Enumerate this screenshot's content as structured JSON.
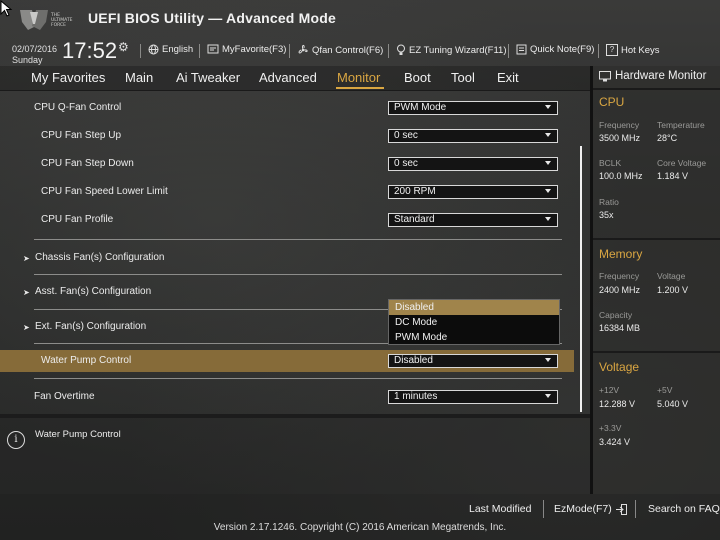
{
  "header": {
    "title": "UEFI BIOS Utility — Advanced Mode",
    "logo_text": "THE ULTIMATE FORCE",
    "date": "02/07/2016",
    "day": "Sunday",
    "time": "17:52",
    "items": [
      {
        "label": "English",
        "icon": "globe-icon"
      },
      {
        "label": "MyFavorite(F3)",
        "icon": "favorite-icon"
      },
      {
        "label": "Qfan Control(F6)",
        "icon": "fan-icon"
      },
      {
        "label": "EZ Tuning Wizard(F11)",
        "icon": "bulb-icon"
      },
      {
        "label": "Quick Note(F9)",
        "icon": "note-icon"
      },
      {
        "label": "Hot Keys",
        "icon": "help-icon"
      }
    ]
  },
  "menu": {
    "tabs": [
      "My Favorites",
      "Main",
      "Ai Tweaker",
      "Advanced",
      "Monitor",
      "Boot",
      "Tool",
      "Exit"
    ],
    "active": "Monitor"
  },
  "settings": {
    "cpu_qfan": {
      "label": "CPU Q-Fan Control",
      "value": "PWM Mode"
    },
    "step_up": {
      "label": "CPU Fan Step Up",
      "value": "0 sec"
    },
    "step_down": {
      "label": "CPU Fan Step Down",
      "value": "0 sec"
    },
    "lower_limit": {
      "label": "CPU Fan Speed Lower Limit",
      "value": "200 RPM"
    },
    "profile": {
      "label": "CPU Fan Profile",
      "value": "Standard"
    },
    "chassis": {
      "label": "Chassis Fan(s) Configuration"
    },
    "asst": {
      "label": "Asst. Fan(s) Configuration"
    },
    "ext": {
      "label": "Ext. Fan(s) Configuration"
    },
    "water_pump": {
      "label": "Water Pump Control",
      "value": "Disabled"
    },
    "fan_overtime": {
      "label": "Fan Overtime",
      "value": "1 minutes"
    }
  },
  "dropdown": {
    "options": [
      "Disabled",
      "DC Mode",
      "PWM Mode"
    ],
    "selected": "Disabled"
  },
  "help": {
    "text": "Water Pump Control"
  },
  "hw_monitor": {
    "title": "Hardware Monitor",
    "cpu": {
      "section": "CPU",
      "frequency_label": "Frequency",
      "frequency": "3500 MHz",
      "temperature_label": "Temperature",
      "temperature": "28°C",
      "bclk_label": "BCLK",
      "bclk": "100.0 MHz",
      "core_voltage_label": "Core Voltage",
      "core_voltage": "1.184 V",
      "ratio_label": "Ratio",
      "ratio": "35x"
    },
    "memory": {
      "section": "Memory",
      "frequency_label": "Frequency",
      "frequency": "2400 MHz",
      "voltage_label": "Voltage",
      "voltage": "1.200 V",
      "capacity_label": "Capacity",
      "capacity": "16384 MB"
    },
    "voltage": {
      "section": "Voltage",
      "v12_label": "+12V",
      "v12": "12.288 V",
      "v5_label": "+5V",
      "v5": "5.040 V",
      "v33_label": "+3.3V",
      "v33": "3.424 V"
    }
  },
  "footer": {
    "last_modified": "Last Modified",
    "ezmode": "EzMode(F7)",
    "search_faq": "Search on FAQ",
    "copyright": "Version 2.17.1246. Copyright (C) 2016 American Megatrends, Inc."
  },
  "colors": {
    "accent": "#d9a642",
    "highlight_row": "#866b39",
    "dropdown_selected": "#a0844b"
  }
}
